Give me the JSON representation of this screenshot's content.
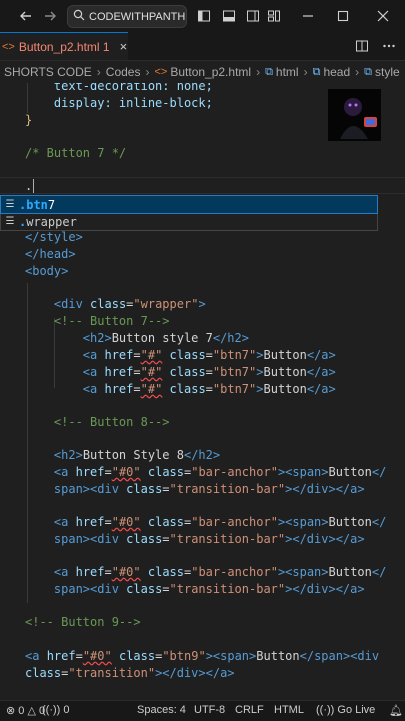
{
  "titlebar": {
    "search_text": "CODEWITHPANTHER",
    "back_icon": "arrow-left-icon",
    "forward_icon": "arrow-right-icon"
  },
  "tab": {
    "label": "Button_p2.html 1",
    "icon": "html-file-icon",
    "close": "×"
  },
  "breadcrumb": [
    "SHORTS CODE",
    "Codes",
    "Button_p2.html",
    "html",
    "head",
    "style"
  ],
  "suggestions": [
    {
      "match": ".btn",
      "rest": "7"
    },
    {
      "match": ".",
      "rest": "wrapper"
    }
  ],
  "code": {
    "l1": "    text-decoration: none;",
    "l2": "    display: inline-block;",
    "l3": "}",
    "l4": "/* Button 7 */",
    "l5": ".",
    "close_style": "</style>",
    "close_head": "</head>",
    "open_body": "<body>",
    "h2_7": "Button style 7",
    "btn_text": "Button",
    "cm7": "<!-- Button 7-->",
    "cm8": "<!-- Button 8-->",
    "h2_8": "Button Style 8",
    "cm9": "<!-- Button 9-->",
    "cls_wrapper": "\"wrapper\"",
    "cls_btn7": "\"btn7\"",
    "href_hash": "\"#\"",
    "href_0": "\"#0\"",
    "cls_bar": "\"bar-anchor\"",
    "cls_trans_bar": "\"transition-bar\"",
    "cls_btn9": "\"btn9\"",
    "cls_trans": "\"transition\""
  },
  "status": {
    "errors": "0",
    "warnings": "0",
    "ports": "0",
    "spaces": "Spaces: 4",
    "encoding": "UTF-8",
    "eol": "CRLF",
    "language": "HTML",
    "golive": "Go Live"
  },
  "colors": {
    "accent": "#0078d4",
    "tag": "#569cd6",
    "attr": "#9cdcfe",
    "string": "#ce9178",
    "comment": "#6a9955"
  }
}
